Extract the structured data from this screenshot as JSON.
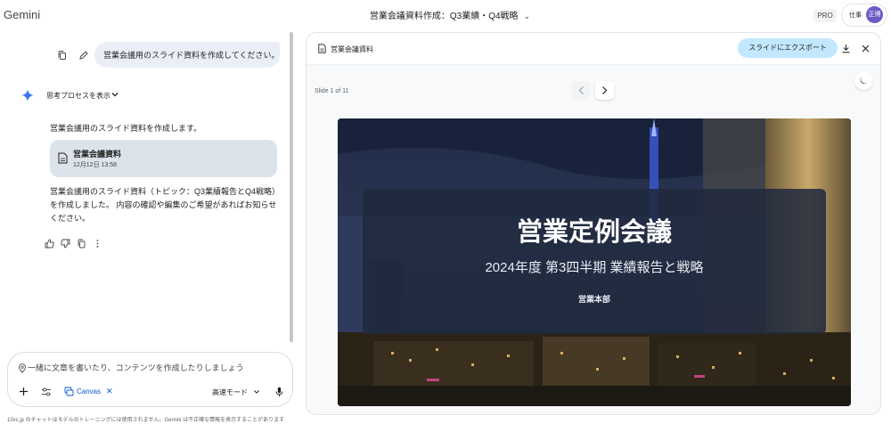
{
  "app": {
    "name": "Gemini"
  },
  "header": {
    "chat_title": "営業会議資料作成：Q3業績・Q4戦略",
    "plan_badge": "PRO",
    "account_label": "仕事",
    "avatar_text": "正博"
  },
  "conversation": {
    "user_message": "営業会議用のスライド資料を作成してください。",
    "thought_toggle": "思考プロセスを表示",
    "reply_intro": "営業会議用のスライド資料を作成します。",
    "file_card": {
      "name": "営業会議資料",
      "date": "12月12日 13:58"
    },
    "reply_summary": "営業会議用のスライド資料（トピック：Q3業績報告とQ4戦略）を作成しました。 内容の確認や編集のご希望があればお知らせください。"
  },
  "composer": {
    "placeholder": "一緒に文章を書いたり、コンテンツを作成したりしましょう",
    "canvas_chip": "Canvas",
    "mode_label": "高速モード",
    "disclaimer": "10xc.jp のチャットはモデルのトレーニングには使用されません。Gemini は不正確な情報を表示することがあります"
  },
  "canvas": {
    "doc_title": "営業会議資料",
    "export_label": "スライドにエクスポート",
    "slide_counter": "Slide 1 of 11",
    "slide": {
      "title": "営業定例会議",
      "subtitle": "2024年度 第3四半期 業績報告と戦略",
      "department": "営業本部"
    }
  },
  "colors": {
    "accent_blue": "#0b57d0",
    "export_button": "#c2e7ff",
    "user_bubble": "#eaeef6",
    "file_card": "#dde3ea",
    "avatar": "#6b5bc7"
  }
}
